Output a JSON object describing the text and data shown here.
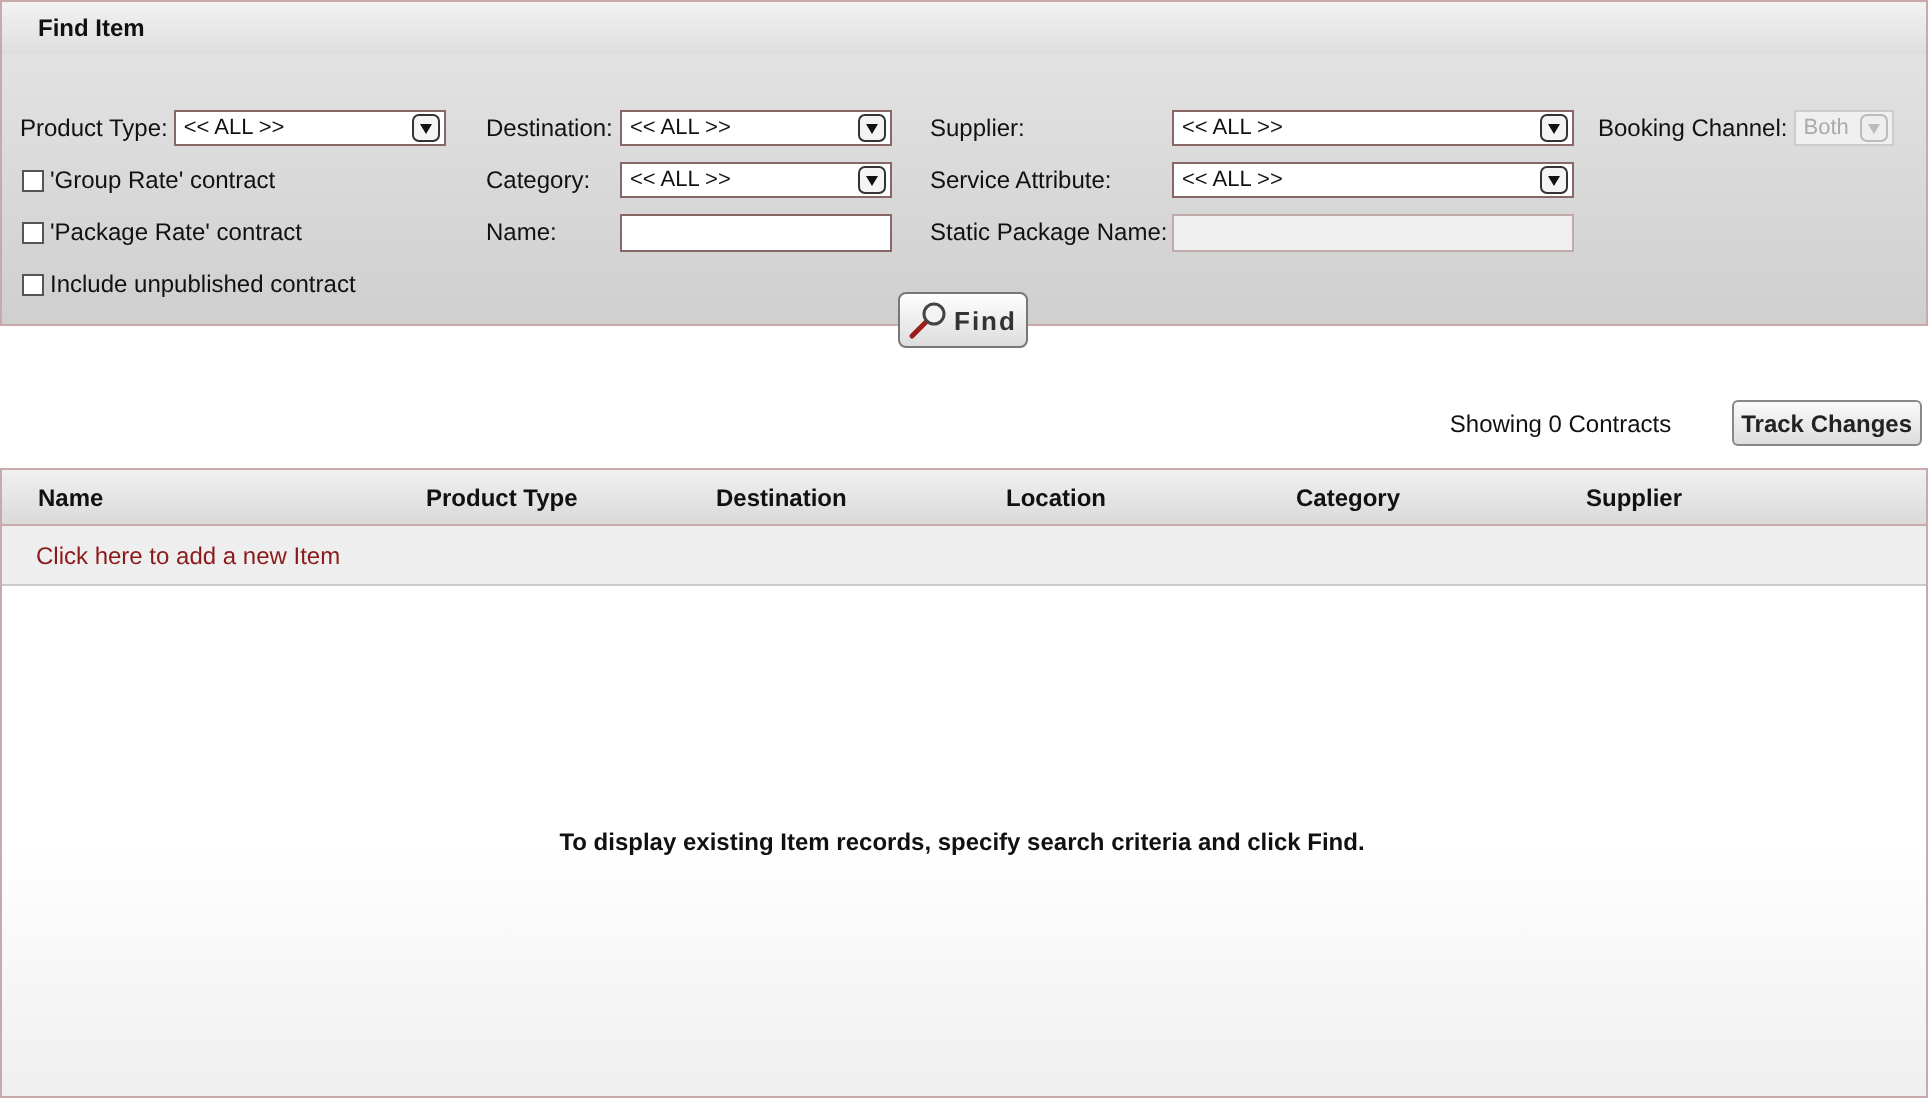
{
  "panel": {
    "title": "Find Item"
  },
  "filters": [
    {
      "kind": "select",
      "label": "Product Type:",
      "value": "<< ALL >>",
      "disabled": false
    },
    {
      "kind": "select",
      "label": "Destination:",
      "value": "<< ALL >>",
      "disabled": false
    },
    {
      "kind": "select",
      "label": "Supplier:",
      "value": "<< ALL >>",
      "disabled": false
    },
    {
      "kind": "select",
      "label": "Booking Channel:",
      "value": "Both",
      "disabled": true
    },
    {
      "kind": "checkbox",
      "label": "'Group Rate' contract",
      "checked": false
    },
    {
      "kind": "select",
      "label": "Category:",
      "value": "<< ALL >>",
      "disabled": false
    },
    {
      "kind": "select",
      "label": "Service Attribute:",
      "value": "<< ALL >>",
      "disabled": false
    },
    {
      "kind": "empty"
    },
    {
      "kind": "checkbox",
      "label": "'Package Rate' contract",
      "checked": false
    },
    {
      "kind": "text",
      "label": "Name:",
      "disabled": false
    },
    {
      "kind": "text",
      "label": "Static Package Name:",
      "disabled": true
    },
    {
      "kind": "empty"
    },
    {
      "kind": "checkbox",
      "label": "Include unpublished contract",
      "checked": false
    }
  ],
  "find_button": "Find",
  "result_count": "Showing 0 Contracts",
  "track_changes_button": "Track Changes",
  "table": {
    "columns": [
      "Name",
      "Product Type",
      "Destination",
      "Location",
      "Category",
      "Supplier"
    ],
    "add_link": "Click here to add a new Item",
    "empty_message": "To display existing Item records, specify search criteria and click Find."
  }
}
